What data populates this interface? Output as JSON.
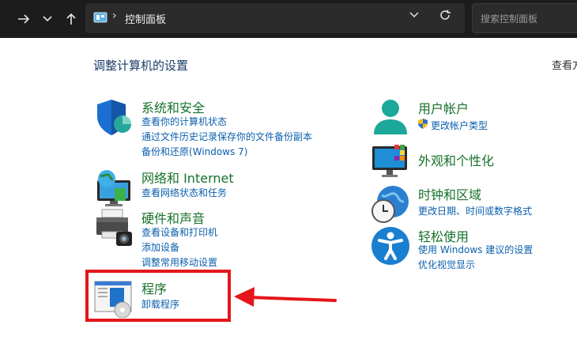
{
  "address_bar": {
    "breadcrumb": "控制面板"
  },
  "search": {
    "placeholder": "搜索控制面板"
  },
  "main": {
    "title": "调整计算机的设置",
    "view_by": "查看方"
  },
  "left_categories": [
    {
      "title": "系统和安全",
      "links": [
        "查看你的计算机状态",
        "通过文件历史记录保存你的文件备份副本",
        "备份和还原(Windows 7)"
      ]
    },
    {
      "title": "网络和 Internet",
      "links": [
        "查看网络状态和任务"
      ]
    },
    {
      "title": "硬件和声音",
      "links": [
        "查看设备和打印机",
        "添加设备",
        "调整常用移动设置"
      ]
    },
    {
      "title": "程序",
      "links": [
        "卸载程序"
      ]
    }
  ],
  "right_categories": [
    {
      "title": "用户帐户",
      "links": [
        "更改帐户类型"
      ]
    },
    {
      "title": "外观和个性化",
      "links": []
    },
    {
      "title": "时钟和区域",
      "links": [
        "更改日期、时间或数字格式"
      ]
    },
    {
      "title": "轻松使用",
      "links": [
        "使用 Windows 建议的设置",
        "优化视觉显示"
      ]
    }
  ],
  "annotation": {
    "highlight_color": "#e4161b"
  }
}
